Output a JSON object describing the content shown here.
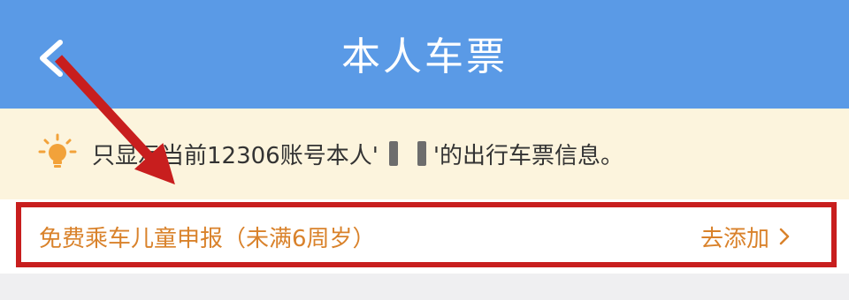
{
  "header": {
    "title": "本人车票",
    "back_icon": "chevron-left-icon",
    "background": "#5a9ae6"
  },
  "notice": {
    "icon": "lightbulb-icon",
    "text_before": "只显示当前12306账号本人'",
    "text_after": "'的出行车票信息。",
    "background": "#fcf4dd"
  },
  "child_row": {
    "label": "免费乘车儿童申报（未满6周岁）",
    "action_label": "去添加",
    "chevron_icon": "chevron-right-icon",
    "text_color": "#d9822b"
  },
  "annotation": {
    "color": "#c81e1e",
    "arrow_icon": "red-arrow-annotation",
    "highlight": "red-highlight-box"
  }
}
